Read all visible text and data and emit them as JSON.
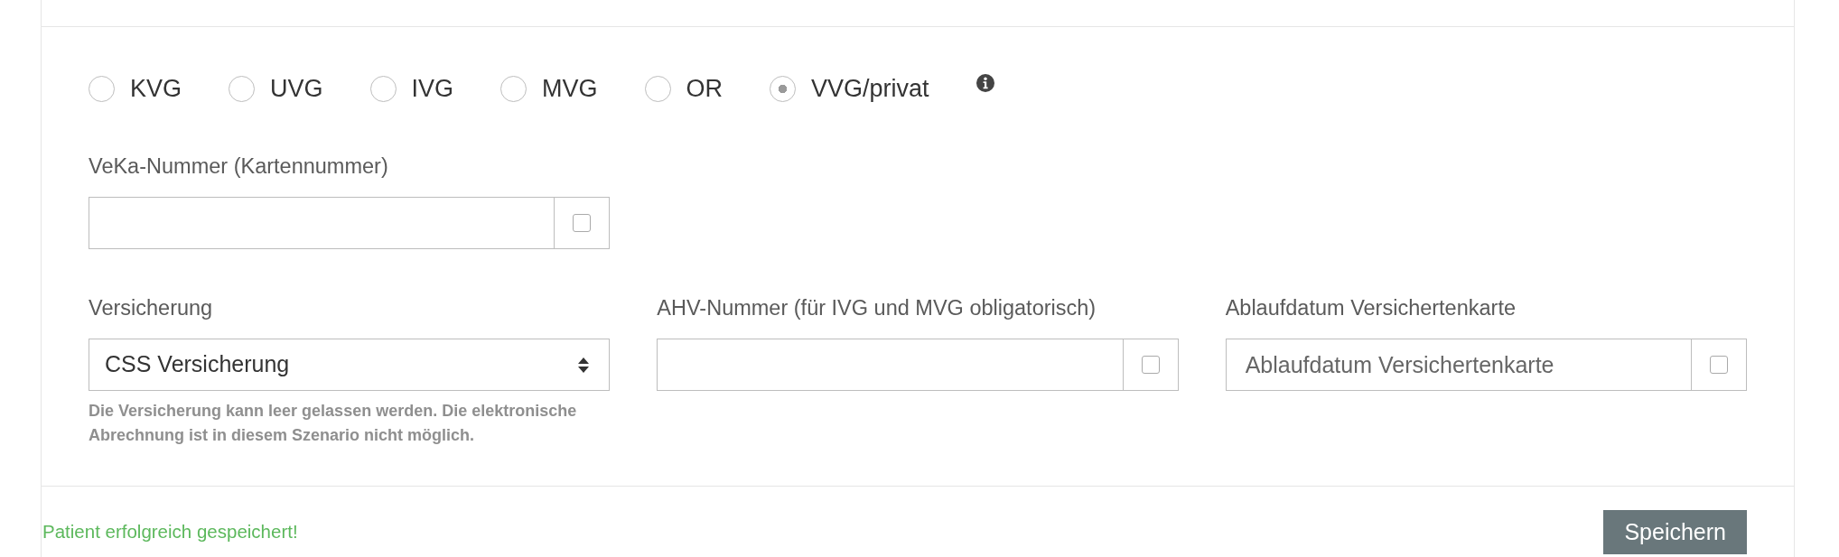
{
  "insurance_types": [
    {
      "label": "KVG",
      "selected": false
    },
    {
      "label": "UVG",
      "selected": false
    },
    {
      "label": "IVG",
      "selected": false
    },
    {
      "label": "MVG",
      "selected": false
    },
    {
      "label": "OR",
      "selected": false
    },
    {
      "label": "VVG/privat",
      "selected": true
    }
  ],
  "rows": [
    [
      {
        "kind": "input",
        "label": "VeKa-Nummer (Kartennummer)",
        "checked": false
      }
    ],
    [
      {
        "kind": "select",
        "label": "Versicherung",
        "value": "CSS Versicherung",
        "help": "Die Versicherung kann leer gelassen werden. Die elektronische Abrechnung ist in diesem Szenario nicht möglich."
      },
      {
        "kind": "input",
        "label": "AHV-Nummer (für IVG und MVG obligatorisch)",
        "checked": false
      },
      {
        "kind": "input",
        "label": "Ablaufdatum Versichertenkarte",
        "placeholder": "Ablaufdatum Versichertenkarte",
        "checked": false
      }
    ]
  ],
  "footer": {
    "message": "Patient erfolgreich gespeichert!",
    "save_button": "Speichern"
  }
}
